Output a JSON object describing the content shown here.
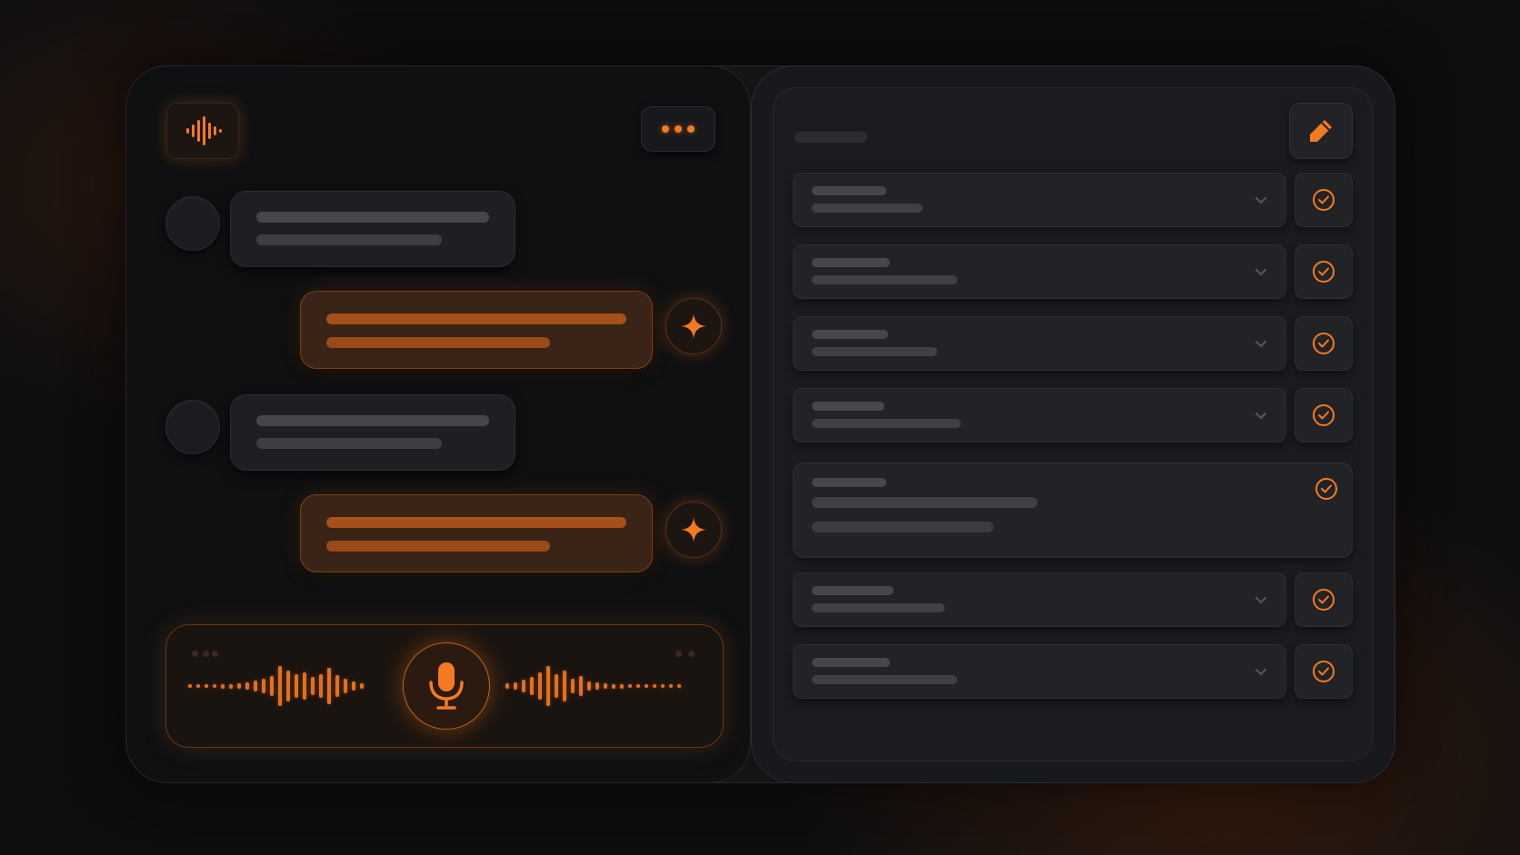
{
  "theme": {
    "accent": "#f47a20",
    "background": "#0d0e10",
    "panel": "#18191c"
  },
  "header": {
    "logo_icon": "waveform-icon",
    "menu_icon": "more-dots-icon"
  },
  "chat": {
    "messages": [
      {
        "role": "user",
        "avatar": "avatar"
      },
      {
        "role": "assistant",
        "icon": "sparkle-icon"
      },
      {
        "role": "user",
        "avatar": "avatar"
      },
      {
        "role": "assistant",
        "icon": "sparkle-icon"
      }
    ],
    "voice_input": {
      "icon": "microphone-icon"
    }
  },
  "tasks": {
    "edit_icon": "pencil-icon",
    "items": [
      {
        "checked": true,
        "expandable": true
      },
      {
        "checked": true,
        "expandable": true
      },
      {
        "checked": true,
        "expandable": true
      },
      {
        "checked": true,
        "expandable": true
      },
      {
        "checked": true,
        "expandable": false,
        "expanded": true
      },
      {
        "checked": true,
        "expandable": true
      },
      {
        "checked": true,
        "expandable": true
      }
    ]
  }
}
